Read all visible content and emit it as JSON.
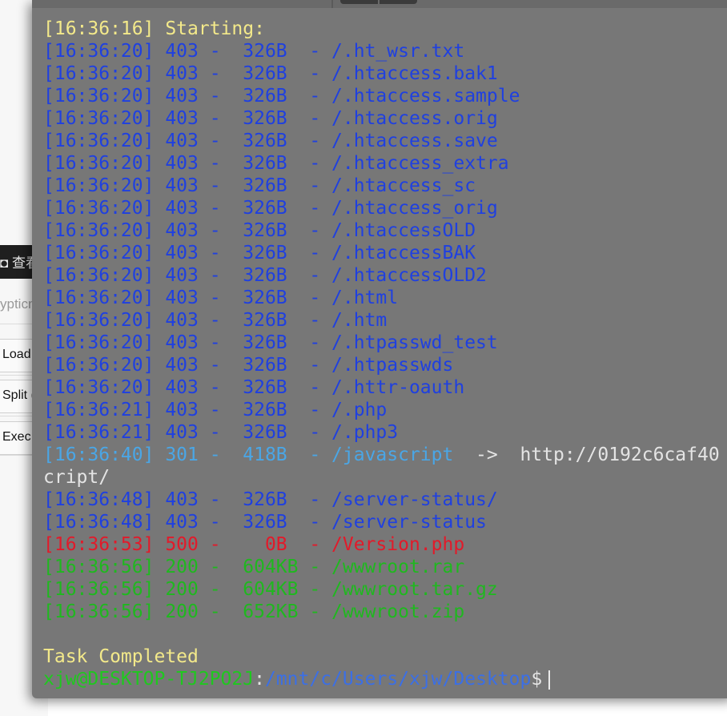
{
  "background_page": {
    "dark_bar_text": "◘ 查看",
    "input_placeholder": "ypticn",
    "buttons": [
      "Load",
      "Split (",
      "Exec"
    ]
  },
  "terminal": {
    "lines": [
      {
        "text": "[16:36:16] Starting:",
        "color": "yellow"
      },
      {
        "text": "[16:36:20] 403 -  326B  - /.ht_wsr.txt",
        "color": "blue"
      },
      {
        "text": "[16:36:20] 403 -  326B  - /.htaccess.bak1",
        "color": "blue"
      },
      {
        "text": "[16:36:20] 403 -  326B  - /.htaccess.sample",
        "color": "blue"
      },
      {
        "text": "[16:36:20] 403 -  326B  - /.htaccess.orig",
        "color": "blue"
      },
      {
        "text": "[16:36:20] 403 -  326B  - /.htaccess.save",
        "color": "blue"
      },
      {
        "text": "[16:36:20] 403 -  326B  - /.htaccess_extra",
        "color": "blue"
      },
      {
        "text": "[16:36:20] 403 -  326B  - /.htaccess_sc",
        "color": "blue"
      },
      {
        "text": "[16:36:20] 403 -  326B  - /.htaccess_orig",
        "color": "blue"
      },
      {
        "text": "[16:36:20] 403 -  326B  - /.htaccessOLD",
        "color": "blue"
      },
      {
        "text": "[16:36:20] 403 -  326B  - /.htaccessBAK",
        "color": "blue"
      },
      {
        "text": "[16:36:20] 403 -  326B  - /.htaccessOLD2",
        "color": "blue"
      },
      {
        "text": "[16:36:20] 403 -  326B  - /.html",
        "color": "blue"
      },
      {
        "text": "[16:36:20] 403 -  326B  - /.htm",
        "color": "blue"
      },
      {
        "text": "[16:36:20] 403 -  326B  - /.htpasswd_test",
        "color": "blue"
      },
      {
        "text": "[16:36:20] 403 -  326B  - /.htpasswds",
        "color": "blue"
      },
      {
        "text": "[16:36:20] 403 -  326B  - /.httr-oauth",
        "color": "blue"
      },
      {
        "text": "[16:36:21] 403 -  326B  - /.php",
        "color": "blue"
      },
      {
        "text": "[16:36:21] 403 -  326B  - /.php3",
        "color": "blue"
      },
      {
        "text": "[16:36:40] 301 -  418B  - /javascript",
        "color": "cyan",
        "suffix": "  ->  http://0192c6caf40"
      },
      {
        "text": "cript/",
        "color": "white"
      },
      {
        "text": "[16:36:48] 403 -  326B  - /server-status/",
        "color": "blue"
      },
      {
        "text": "[16:36:48] 403 -  326B  - /server-status",
        "color": "blue"
      },
      {
        "text": "[16:36:53] 500 -    0B  - /Version.php",
        "color": "red"
      },
      {
        "text": "[16:36:56] 200 -  604KB - /wwwroot.rar",
        "color": "green"
      },
      {
        "text": "[16:36:56] 200 -  604KB - /wwwroot.tar.gz",
        "color": "green"
      },
      {
        "text": "[16:36:56] 200 -  652KB - /wwwroot.zip",
        "color": "green"
      },
      {
        "text": "",
        "color": "white"
      },
      {
        "text": "Task Completed",
        "color": "yellow"
      }
    ],
    "prompt": {
      "user_host": "xjw@DESKTOP-TJ2PO2J",
      "separator": ":",
      "path": "/mnt/c/Users/xjw/Desktop",
      "symbol": "$"
    }
  },
  "colors": {
    "yellow": "#f3e98a",
    "blue": "#1f40e0",
    "cyan": "#4aa6e6",
    "white": "#e4e4e4",
    "red": "#e21a2a",
    "green": "#1fb81f",
    "terminal_bg": "#777777"
  }
}
